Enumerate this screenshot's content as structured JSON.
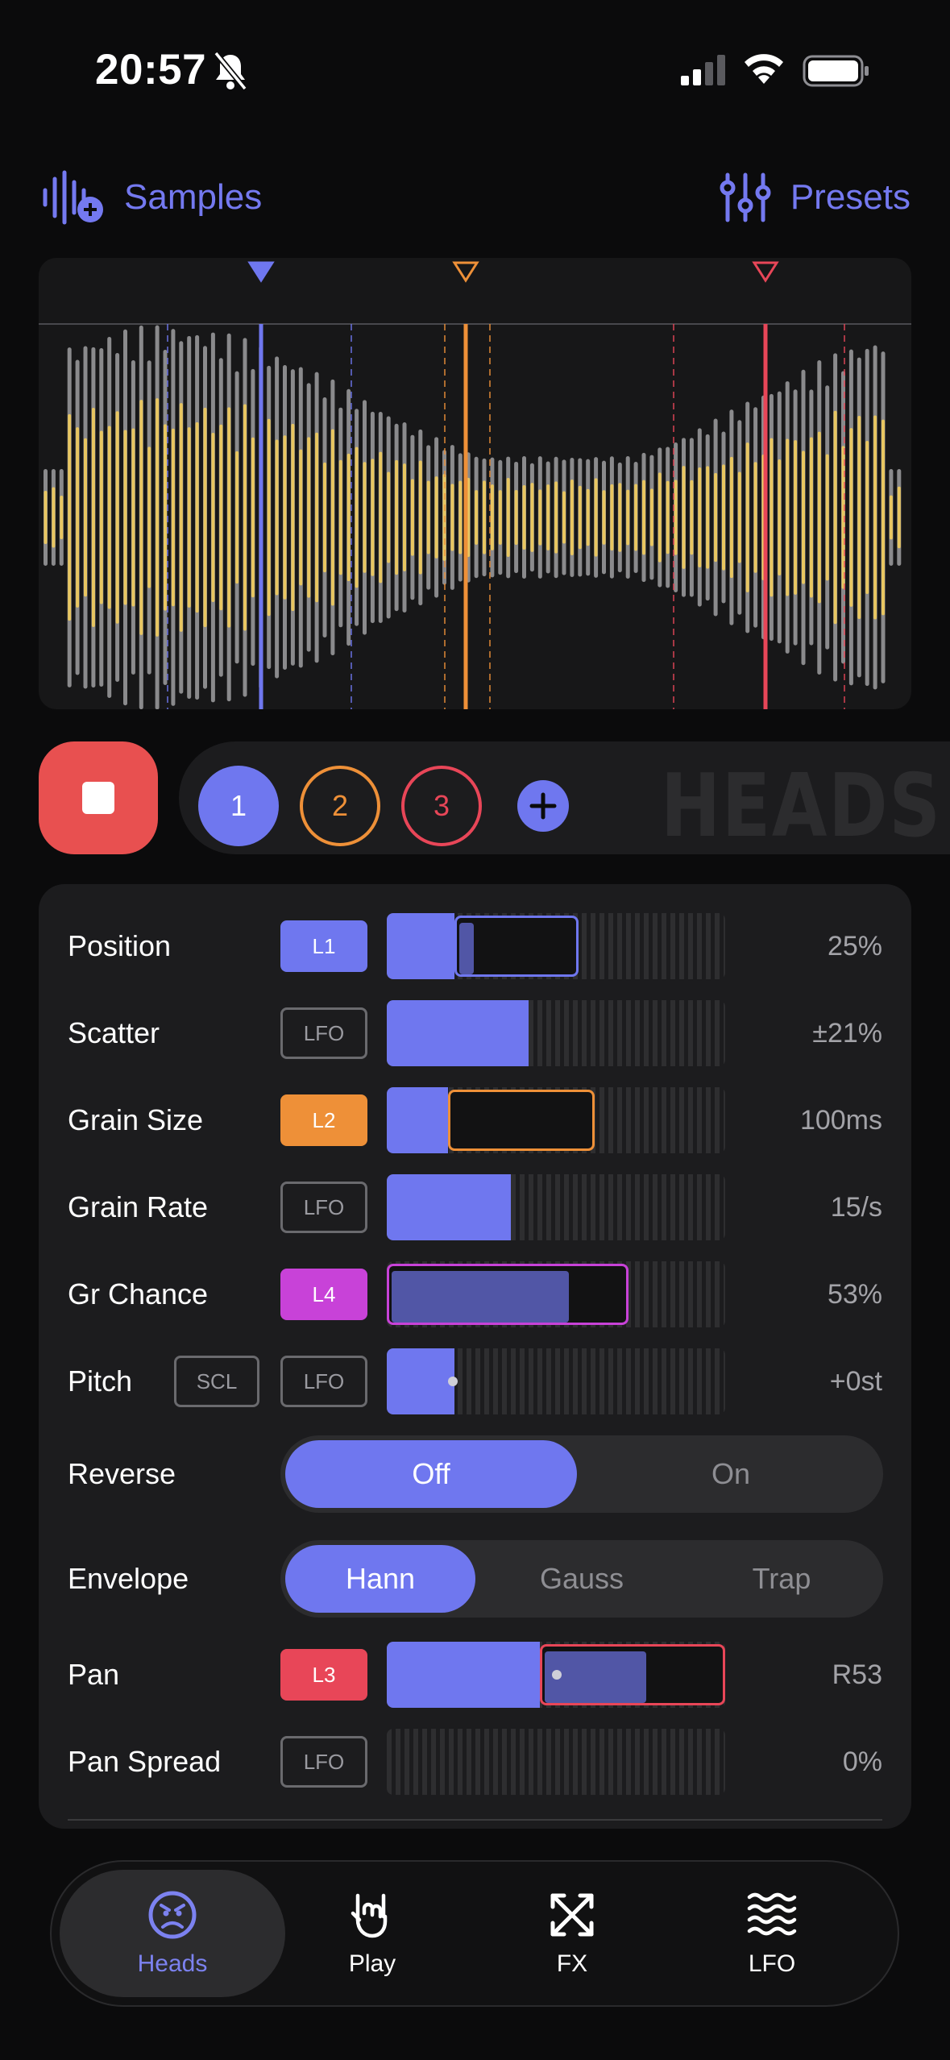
{
  "status": {
    "time": "20:57",
    "icons": [
      "bell-slash-icon",
      "cellular-signal-icon",
      "wifi-icon",
      "battery-icon"
    ]
  },
  "nav": {
    "samples_label": "Samples",
    "presets_label": "Presets",
    "accent_color": "#7479f0"
  },
  "waveform": {
    "head_colors": [
      "#6f77ef",
      "#ee9038",
      "#e84658"
    ],
    "wave_colors": {
      "outer": "#8a8a8c",
      "inner": "#e8c661"
    }
  },
  "transport": {
    "heads": [
      "1",
      "2",
      "3"
    ],
    "watermark": "HEADS"
  },
  "params": {
    "position": {
      "label": "Position",
      "mod": "L1",
      "value": "25%",
      "level": 0.2
    },
    "scatter": {
      "label": "Scatter",
      "mod": "LFO",
      "value": "±21%",
      "level": 0.42
    },
    "grain_size": {
      "label": "Grain Size",
      "mod": "L2",
      "value": "100ms",
      "level": 0.18
    },
    "grain_rate": {
      "label": "Grain Rate",
      "mod": "LFO",
      "value": "15/s",
      "level": 0.37
    },
    "gr_chance": {
      "label": "Gr Chance",
      "mod": "L4",
      "value": "53%",
      "level": 0.53
    },
    "pitch": {
      "label": "Pitch",
      "scl": "SCL",
      "mod": "LFO",
      "value": "+0st",
      "level": 0.2
    },
    "reverse": {
      "label": "Reverse",
      "options": [
        "Off",
        "On"
      ],
      "selected": "Off"
    },
    "envelope": {
      "label": "Envelope",
      "options": [
        "Hann",
        "Gauss",
        "Trap"
      ],
      "selected": "Hann"
    },
    "pan": {
      "label": "Pan",
      "mod": "L3",
      "value": "R53",
      "level": 0.45
    },
    "pan_spread": {
      "label": "Pan Spread",
      "mod": "LFO",
      "value": "0%",
      "level": 0
    }
  },
  "mod_colors": {
    "L1": "#6f77ef",
    "L2": "#ee9038",
    "L3": "#e84658",
    "L4": "#c842d8"
  },
  "tabs": [
    {
      "label": "Heads",
      "icon": "angry-face-icon",
      "active": true
    },
    {
      "label": "Play",
      "icon": "rock-hand-icon",
      "active": false
    },
    {
      "label": "FX",
      "icon": "crossing-arrows-icon",
      "active": false
    },
    {
      "label": "LFO",
      "icon": "waves-icon",
      "active": false
    }
  ]
}
